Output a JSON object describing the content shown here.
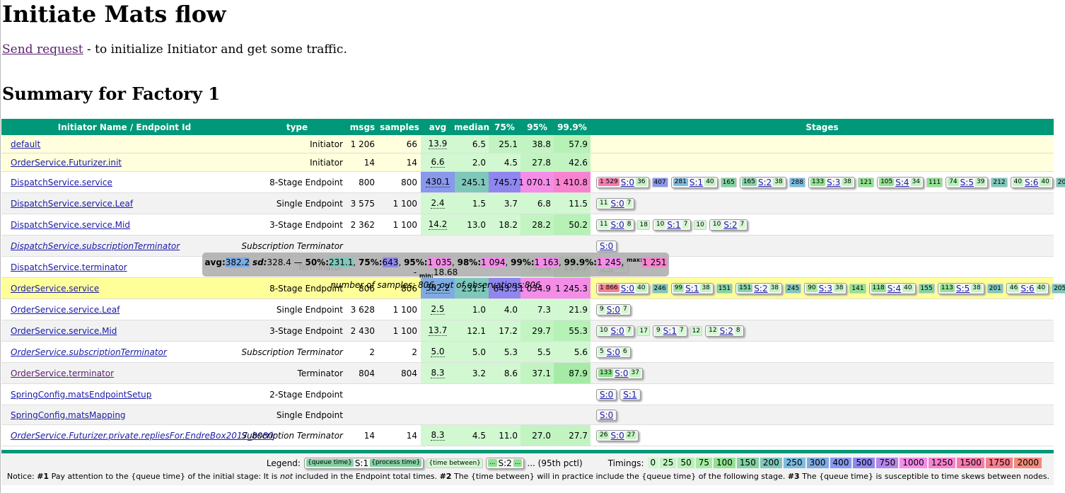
{
  "title": "Initiate Mats flow",
  "intro": {
    "link": "Send request",
    "text": " - to initialize Initiator and get some traffic."
  },
  "summary_title": "Summary for Factory 1",
  "headers": [
    "Initiator Name / Endpoint Id",
    "type",
    "msgs",
    "samples",
    "avg",
    "median",
    "75%",
    "95%",
    "99.9%",
    "Stages"
  ],
  "colors": {
    "header": "#009879",
    "t0": "#d2f8d2",
    "t25": "#c2f4c2",
    "t50": "#b6f1b6",
    "t75": "#a5eba5",
    "t100": "#92e292",
    "t150": "#84d3a3",
    "t200": "#80c7bb",
    "t250": "#7dbce0",
    "t300": "#7eabe2",
    "t400": "#8898ec",
    "t500": "#8f86ee",
    "t750": "#b287ea",
    "t1000": "#f38de8",
    "t1250": "#f783cf",
    "t1500": "#f67aae",
    "t1750": "#f67f8e",
    "t2000": "#f48a7a"
  },
  "rows": [
    {
      "name": "default",
      "type": "Initiator",
      "msgs": "1 206",
      "samples": "66",
      "avg": "13.9",
      "median": "6.5",
      "p75": "25.1",
      "p95": "38.8",
      "p999": "57.9",
      "bg": "#ffffdd",
      "stages": []
    },
    {
      "name": "OrderService.Futurizer.init",
      "type": "Initiator",
      "msgs": "14",
      "samples": "14",
      "avg": "6.6",
      "median": "2.0",
      "p75": "4.5",
      "p95": "27.8",
      "p999": "42.6",
      "bg": "#ffffdd",
      "stages": []
    },
    {
      "name": "DispatchService.service",
      "type": "8-Stage Endpoint",
      "msgs": "800",
      "samples": "800",
      "avg": "430.1",
      "median": "245.1",
      "p75": "745.7",
      "p95": "1 070.1",
      "p999": "1 410.8",
      "bg": "#ffffff",
      "stages": [
        {
          "qt": "1 529",
          "label": "S:0",
          "pt": "36"
        },
        {
          "tb": "407"
        },
        {
          "qt": "281",
          "label": "S:1",
          "pt": "40"
        },
        {
          "tb": "165"
        },
        {
          "qt": "165",
          "label": "S:2",
          "pt": "38"
        },
        {
          "tb": "288"
        },
        {
          "qt": "133",
          "label": "S:3",
          "pt": "38"
        },
        {
          "tb": "121"
        },
        {
          "qt": "105",
          "label": "S:4",
          "pt": "34"
        },
        {
          "tb": "111"
        },
        {
          "qt": "74",
          "label": "S:5",
          "pt": "39"
        },
        {
          "tb": "212"
        },
        {
          "qt": "40",
          "label": "S:6",
          "pt": "40"
        },
        {
          "tb": "205"
        },
        {
          "qt": "40",
          "label": "S:7",
          "pt": "40"
        }
      ]
    },
    {
      "name": "DispatchService.service.Leaf",
      "type": "Single Endpoint",
      "msgs": "3 575",
      "samples": "1 100",
      "avg": "2.4",
      "median": "1.5",
      "p75": "3.7",
      "p95": "6.8",
      "p999": "11.5",
      "bg": "#f2f2f2",
      "stages": [
        {
          "qt": "11",
          "label": "S:0",
          "pt": "7"
        }
      ]
    },
    {
      "name": "DispatchService.service.Mid",
      "type": "3-Stage Endpoint",
      "msgs": "2 362",
      "samples": "1 100",
      "avg": "14.2",
      "median": "13.0",
      "p75": "18.2",
      "p95": "28.2",
      "p999": "50.2",
      "bg": "#ffffff",
      "stages": [
        {
          "qt": "11",
          "label": "S:0",
          "pt": "8"
        },
        {
          "tb": "18"
        },
        {
          "qt": "10",
          "label": "S:1",
          "pt": "7"
        },
        {
          "tb": "10"
        },
        {
          "qt": "10",
          "label": "S:2",
          "pt": "7"
        }
      ]
    },
    {
      "name": "DispatchService.subscriptionTerminator",
      "type": "Subscription Terminator",
      "msgs": "",
      "samples": "",
      "avg": "",
      "median": "",
      "p75": "",
      "p95": "",
      "p999": "",
      "bg": "#f2f2f2",
      "italic": true,
      "stages": [
        {
          "label": "S:0"
        }
      ]
    },
    {
      "name": "DispatchService.terminator",
      "type": "Terminator",
      "msgs": "",
      "samples": "",
      "avg": "",
      "median": "",
      "p75": "",
      "p95": "33.6",
      "p999": "119.7",
      "bg": "#ffffff",
      "stages": [
        {
          "qt": "",
          "label": "S:0",
          "pt": "34"
        }
      ]
    },
    {
      "name": "OrderService.service",
      "type": "8-Stage Endpoint",
      "msgs": "806",
      "samples": "806",
      "avg": "382.2",
      "median": "231.1",
      "p75": "643.3",
      "p95": "1 034.9",
      "p999": "1 245.3",
      "bg": "#ffff99",
      "stages": [
        {
          "qt": "1 866",
          "label": "S:0",
          "pt": "40"
        },
        {
          "tb": "246"
        },
        {
          "qt": "99",
          "label": "S:1",
          "pt": "38"
        },
        {
          "tb": "151"
        },
        {
          "qt": "151",
          "label": "S:2",
          "pt": "38"
        },
        {
          "tb": "245"
        },
        {
          "qt": "90",
          "label": "S:3",
          "pt": "38"
        },
        {
          "tb": "141"
        },
        {
          "qt": "118",
          "label": "S:4",
          "pt": "40"
        },
        {
          "tb": "155"
        },
        {
          "qt": "113",
          "label": "S:5",
          "pt": "38"
        },
        {
          "tb": "201"
        },
        {
          "qt": "46",
          "label": "S:6",
          "pt": "40"
        },
        {
          "tb": "205"
        },
        {
          "qt": "48",
          "label": "S:7",
          "pt": "37"
        }
      ]
    },
    {
      "name": "OrderService.service.Leaf",
      "type": "Single Endpoint",
      "msgs": "3 628",
      "samples": "1 100",
      "avg": "2.5",
      "median": "1.0",
      "p75": "4.0",
      "p95": "7.3",
      "p999": "21.9",
      "bg": "#ffffff",
      "stages": [
        {
          "qt": "9",
          "label": "S:0",
          "pt": "7"
        }
      ]
    },
    {
      "name": "OrderService.service.Mid",
      "type": "3-Stage Endpoint",
      "msgs": "2 430",
      "samples": "1 100",
      "avg": "13.7",
      "median": "12.1",
      "p75": "17.2",
      "p95": "29.7",
      "p999": "55.3",
      "bg": "#f2f2f2",
      "stages": [
        {
          "qt": "10",
          "label": "S:0",
          "pt": "7"
        },
        {
          "tb": "17"
        },
        {
          "qt": "9",
          "label": "S:1",
          "pt": "7"
        },
        {
          "tb": "12"
        },
        {
          "qt": "12",
          "label": "S:2",
          "pt": "8"
        }
      ]
    },
    {
      "name": "OrderService.subscriptionTerminator",
      "type": "Subscription Terminator",
      "msgs": "2",
      "samples": "2",
      "avg": "5.0",
      "median": "5.0",
      "p75": "5.3",
      "p95": "5.5",
      "p999": "5.6",
      "bg": "#ffffff",
      "italic": true,
      "stages": [
        {
          "qt": "5",
          "label": "S:0",
          "pt": "6"
        }
      ]
    },
    {
      "name": "OrderService.terminator",
      "type": "Terminator",
      "msgs": "804",
      "samples": "804",
      "avg": "8.3",
      "median": "3.2",
      "p75": "8.6",
      "p95": "37.1",
      "p999": "87.9",
      "bg": "#f2f2f2",
      "visited": true,
      "stages": [
        {
          "qt": "133",
          "label": "S:0",
          "pt": "37"
        }
      ]
    },
    {
      "name": "SpringConfig.matsEndpointSetup",
      "type": "2-Stage Endpoint",
      "msgs": "",
      "samples": "",
      "avg": "",
      "median": "",
      "p75": "",
      "p95": "",
      "p999": "",
      "bg": "#ffffff",
      "stages": [
        {
          "label": "S:0"
        },
        {
          "label": "S:1"
        }
      ]
    },
    {
      "name": "SpringConfig.matsMapping",
      "type": "Single Endpoint",
      "msgs": "",
      "samples": "",
      "avg": "",
      "median": "",
      "p75": "",
      "p95": "",
      "p999": "",
      "bg": "#f2f2f2",
      "stages": [
        {
          "label": "S:0"
        }
      ]
    },
    {
      "name": "OrderService.Futurizer.private.repliesFor.EndreBox2017_8080",
      "type": "Subscription Terminator",
      "msgs": "14",
      "samples": "14",
      "avg": "8.3",
      "median": "4.5",
      "p75": "11.0",
      "p95": "27.0",
      "p999": "27.7",
      "bg": "#ffffff",
      "italic": true,
      "stages": [
        {
          "qt": "26",
          "label": "S:0",
          "pt": "27"
        }
      ]
    }
  ],
  "tooltip": {
    "avg_label": "avg:",
    "avg": "382.2",
    "sd_label": "sd:",
    "sd": "328.4",
    "dash": " — ",
    "p50_label": "50%:",
    "p50": "231.1",
    "p75_label": "75%:",
    "p75": "643",
    "p95_label": "95%:",
    "p95": "1 035",
    "p98_label": "98%:",
    "p98": "1 094",
    "p99_label": "99%:",
    "p99": "1 163",
    "p999_label": "99.9%:",
    "p999": "1 245",
    "max_label": "max:",
    "max": "1 251",
    "min_label": "min:",
    "min": "18.68",
    "samples_text": "number of samples: 806, out of observations:806"
  },
  "legend": {
    "label": "Legend:",
    "queue_time": "{queue time}",
    "stage1": "S:1",
    "process_time": "{process time}",
    "time_between": "{time between}",
    "ellipsis": "...",
    "stage2": "S:2",
    "ellipsis2": "...",
    "pctl": "... (95th pctl)",
    "timings_label": "Timings:",
    "timings": [
      "0",
      "25",
      "50",
      "75",
      "100",
      "150",
      "200",
      "250",
      "300",
      "400",
      "500",
      "750",
      "1000",
      "1250",
      "1500",
      "1750",
      "2000"
    ]
  },
  "notice": {
    "prefix": "Notice: ",
    "n1": "#1",
    "t1a": " Pay attention to the {queue time} of the initial stage: It is ",
    "t1not": "not",
    "t1b": " included in the Endpoint total times. ",
    "n2": "#2",
    "t2": " The {time between} will in practice include the {queue time} of the following stage. ",
    "n3": "#3",
    "t3": " The {queue time} is susceptible to time skews between nodes."
  }
}
